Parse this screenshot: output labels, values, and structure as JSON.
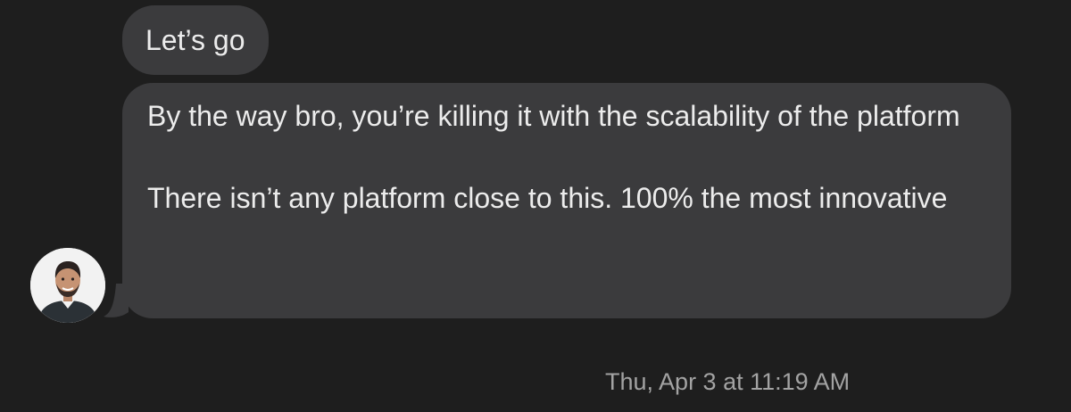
{
  "messages": [
    {
      "paragraphs": [
        "Let’s go"
      ]
    },
    {
      "paragraphs": [
        "By the way bro, you’re killing it with the scalability of the platform",
        "There isn’t any platform close to this. 100% the most innovative"
      ]
    }
  ],
  "timestamp": "Thu, Apr 3 at 11:19 AM",
  "colors": {
    "background": "#1e1e1e",
    "bubble": "#3b3b3d",
    "message_text": "#ececec",
    "timestamp_text": "#a3a3a3"
  },
  "icons": {
    "avatar": "sender-avatar-photo"
  }
}
